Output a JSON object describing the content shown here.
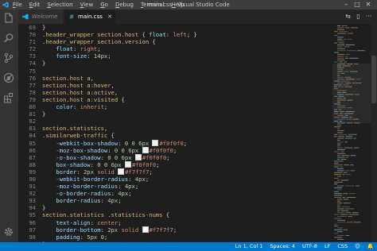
{
  "titlebar": {
    "title": "main.css - Visual Studio Code",
    "menu": [
      {
        "accel": "F",
        "rest": "ile"
      },
      {
        "accel": "E",
        "rest": "dit"
      },
      {
        "accel": "S",
        "rest": "election"
      },
      {
        "accel": "V",
        "rest": "iew"
      },
      {
        "accel": "G",
        "rest": "o"
      },
      {
        "accel": "D",
        "rest": "ebug"
      },
      {
        "accel": "T",
        "rest": "erminal"
      },
      {
        "accel": "H",
        "rest": "elp"
      }
    ],
    "controls": {
      "minimize": "–",
      "maximize": "□",
      "close": "✕"
    }
  },
  "tabs": {
    "welcome": "Welcome",
    "main": "main.css",
    "close": "✕"
  },
  "editor_actions": {
    "split": "⇆",
    "more": "···"
  },
  "editor": {
    "lines": [
      {
        "n": "69",
        "text": "}"
      },
      {
        "n": "70",
        "text": ".header_wrapper section.host { float: left; }"
      },
      {
        "n": "71",
        "text": ".header_wrapper section.version {"
      },
      {
        "n": "72",
        "text": "    float: right;"
      },
      {
        "n": "73",
        "text": "    font-size: 14px;"
      },
      {
        "n": "74",
        "text": "}"
      },
      {
        "n": "75",
        "text": ""
      },
      {
        "n": "76",
        "text": "section.host a,"
      },
      {
        "n": "77",
        "text": "section.host a:hover,"
      },
      {
        "n": "78",
        "text": "section.host a:active,"
      },
      {
        "n": "79",
        "text": "section.host a:visited {"
      },
      {
        "n": "80",
        "text": "    color: inherit;"
      },
      {
        "n": "81",
        "text": "}"
      },
      {
        "n": "82",
        "text": ""
      },
      {
        "n": "83",
        "text": "section.statistics,"
      },
      {
        "n": "84",
        "text": ".similarweb-traffic {"
      },
      {
        "n": "85",
        "text": "    -webkit-box-shadow: 0 0 6px ",
        "swatch": true,
        "after": "#f0f0f0;"
      },
      {
        "n": "86",
        "text": "    -moz-box-shadow: 0 0 6px ",
        "swatch": true,
        "after": "#f0f0f0;"
      },
      {
        "n": "87",
        "text": "    -o-box-shadow: 0 0 6px ",
        "swatch": true,
        "after": "#f0f0f0;"
      },
      {
        "n": "88",
        "text": "    box-shadow: 0 0 6px ",
        "swatch": true,
        "after": "#f0f0f0;"
      },
      {
        "n": "89",
        "text": "    border: 2px solid ",
        "swatch": true,
        "after": "#f7f7f7;"
      },
      {
        "n": "90",
        "text": "    -webkit-border-radius: 4px;"
      },
      {
        "n": "91",
        "text": "    -moz-border-radius: 4px;"
      },
      {
        "n": "92",
        "text": "    -o-border-radius: 4px;"
      },
      {
        "n": "93",
        "text": "    border-radius: 4px;"
      },
      {
        "n": "94",
        "text": "}"
      },
      {
        "n": "95",
        "text": "section.statistics .statistics-nums {"
      },
      {
        "n": "96",
        "text": "    text-align: center;"
      },
      {
        "n": "97",
        "text": "    border-bottom: 2px solid ",
        "swatch": true,
        "after": "#f7f7f7;"
      },
      {
        "n": "98",
        "text": "    padding: 5px 0;"
      },
      {
        "n": "99",
        "text": "}"
      }
    ]
  },
  "statusbar": {
    "position": "Ln 1, Col 1",
    "indent": "Spaces: 4",
    "encoding": "UTF-8",
    "eol": "LF",
    "language": "CSS",
    "feedback": "☺",
    "bell": "🔔"
  },
  "colors": {
    "accent": "#007acc",
    "selector": "#d7ba7d",
    "property": "#9cdcfe",
    "value": "#ce9178",
    "number": "#b5cea8"
  },
  "icons": {
    "activity": [
      "files-icon",
      "search-icon",
      "source-control-icon",
      "debug-icon",
      "extensions-icon",
      "settings-gear-icon"
    ]
  }
}
